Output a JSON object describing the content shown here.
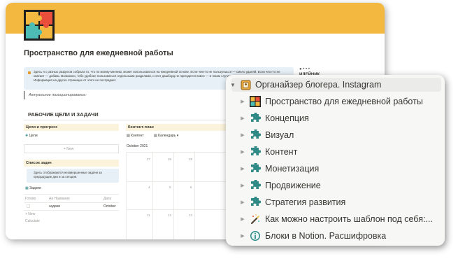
{
  "page": {
    "title": "Пространство для ежедневной работы",
    "callout_text": "Здесь я с разных разделов собрала то, что по моему мнению, может использоваться на ежедневной основе. Если чем-то не пользуешься — смело удаляй. Если чего-то не хватает — добавь. Возможно, тебе удобнее пользоваться отдельными разделами, и этот дашборд не пригодится вовсе — в таком случае можно удалить всю страницу целиком. Информация на других страницах от этого не пострадает.",
    "quote_text": "Актуальное позиционирование:",
    "section_heading": "РАБОЧИЕ ЦЕЛИ И ЗАДАЧИ",
    "side_heading": "ИДЕЙНИК",
    "goals": {
      "header": "Цели и прогресс",
      "item": "Цели",
      "add": "+ New"
    },
    "tasks": {
      "header": "Список задач",
      "note": "Здесь отображаются незавершенные задачи за предыдущие дни и за сегодня.",
      "view_label": "Задачи",
      "col_done": "Готово",
      "col_name": "Aa Название",
      "col_date": "Дата",
      "row_name": "задачи",
      "row_date": "October",
      "add": "+ New",
      "calculate": "Calculate"
    },
    "content_plan": {
      "header": "Контент-план",
      "view_content": "Контент",
      "view_calendar": "Календарь",
      "month": "October 2021",
      "row1": [
        "27",
        "28",
        "29"
      ],
      "row2": [
        "4",
        "5",
        "6"
      ],
      "row3": [
        "11",
        "12",
        "13"
      ]
    }
  },
  "tree": {
    "root": {
      "label": "Органайзер блогера. Instagram",
      "icon": "notebook-icon"
    },
    "items": [
      {
        "label": "Пространство для ежедневной работы",
        "icon": "puzzle-color-icon"
      },
      {
        "label": "Концепция",
        "icon": "puzzle-icon"
      },
      {
        "label": "Визуал",
        "icon": "puzzle-icon"
      },
      {
        "label": "Контент",
        "icon": "puzzle-icon"
      },
      {
        "label": "Монетизация",
        "icon": "puzzle-icon"
      },
      {
        "label": "Продвижение",
        "icon": "puzzle-icon"
      },
      {
        "label": "Стратегия развития",
        "icon": "puzzle-icon"
      },
      {
        "label": "Как можно настроить шаблон под себя:...",
        "icon": "magic-wand-icon"
      },
      {
        "label": "Блоки в Notion. Расшифровка",
        "icon": "info-icon"
      }
    ]
  },
  "colors": {
    "cover": "#f3b840",
    "puzzle_teal": "#2f8a86",
    "callout_bg": "#e7f0f7",
    "panel_bg": "#f7f7f5"
  }
}
